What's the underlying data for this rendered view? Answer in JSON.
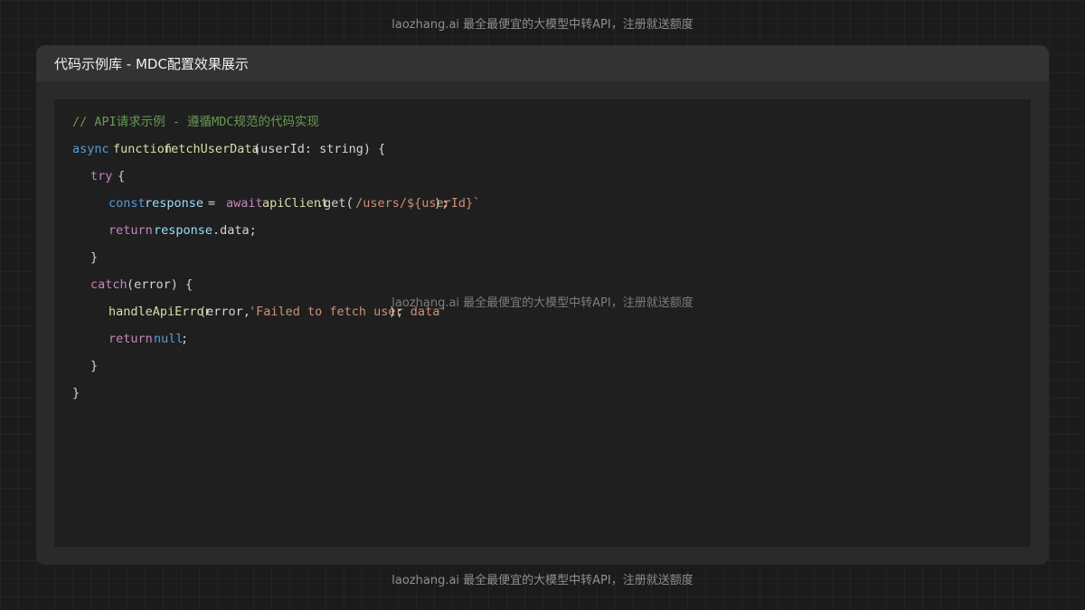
{
  "watermark": {
    "text": "laozhang.ai 最全最便宜的大模型中转API，注册就送额度"
  },
  "panel": {
    "title": "代码示例库 - MDC配置效果展示"
  },
  "code": {
    "line1": {
      "comment": "// API请求示例 - 遵循MDC规范的代码实现"
    },
    "line2": {
      "async": "async",
      "function": "function",
      "name": "fetchUserData",
      "params": "(userId: string) {"
    },
    "line3": {
      "try": "try",
      "brace": "{"
    },
    "line4": {
      "const": "const",
      "var": "response",
      "eq": "=",
      "await": "await",
      "obj": "apiClient",
      "call": ".get(",
      "str": "`/users/${userId}`",
      "end": ");"
    },
    "line5": {
      "return": "return",
      "var": "response",
      "rest": ".data;"
    },
    "line6": {
      "brace": "}"
    },
    "line7": {
      "catch": "catch",
      "rest": "(error) {"
    },
    "line8": {
      "fn": "handleApiError",
      "args": "(error,",
      "str": "'Failed to fetch user data'",
      "end": ");"
    },
    "line9": {
      "return": "return",
      "null": "null",
      "end": ";"
    },
    "line10": {
      "brace": "}"
    },
    "line11": {
      "brace": "}"
    }
  },
  "colors": {
    "comment": "#6a9955",
    "keyword": "#569cd6",
    "control": "#c586c0",
    "function": "#dcdcaa",
    "variable": "#9cdcfe",
    "string": "#ce9178"
  }
}
